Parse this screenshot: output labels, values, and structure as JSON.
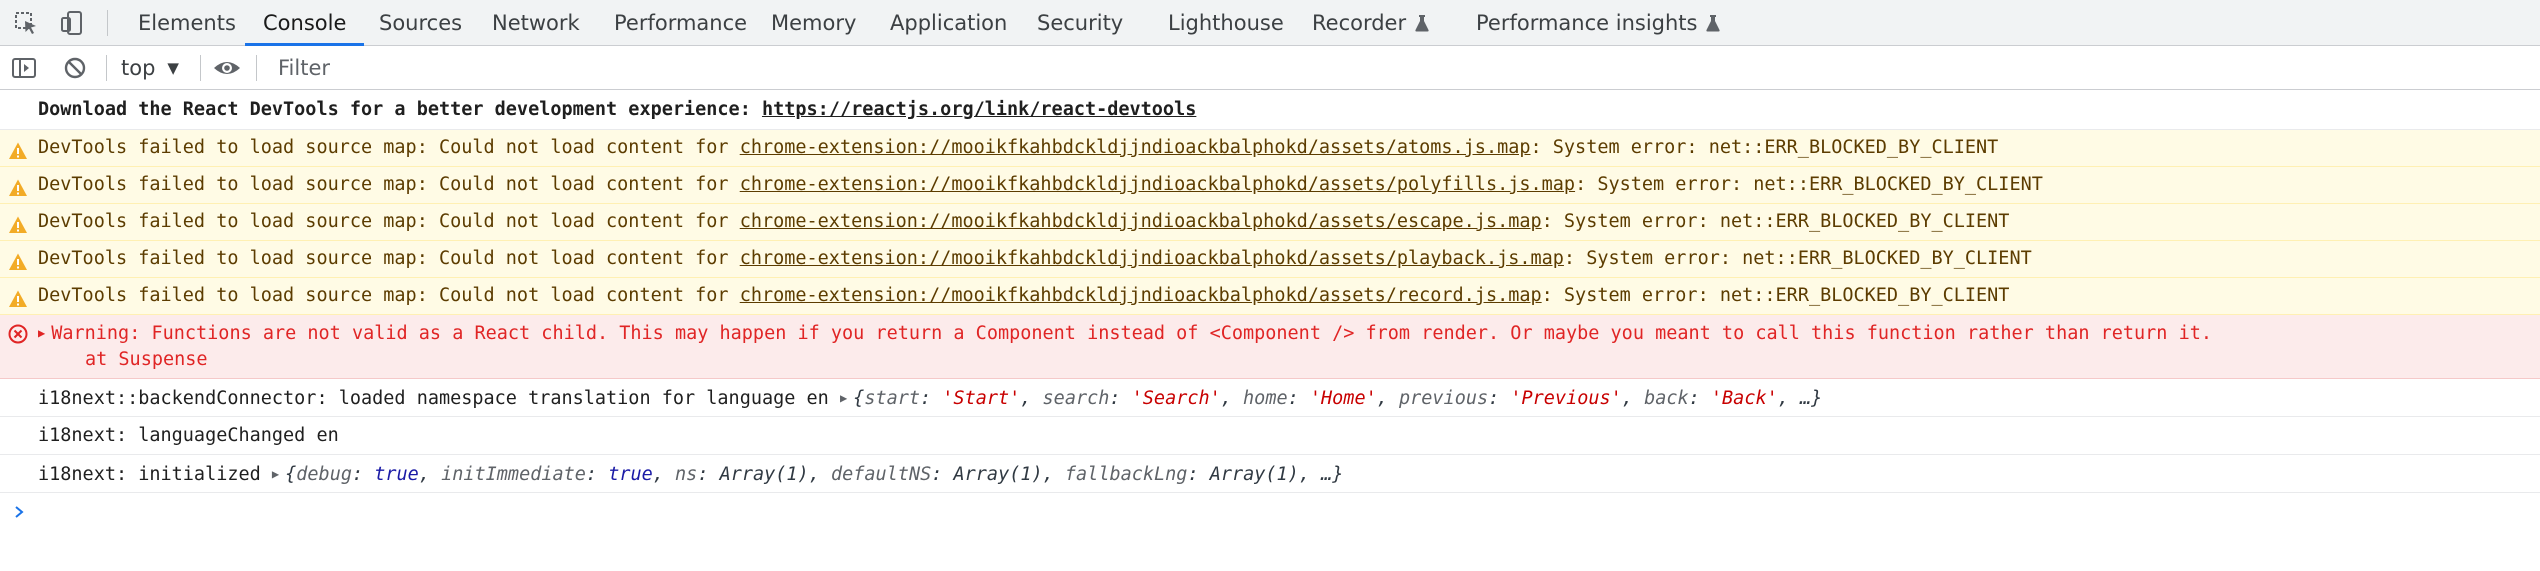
{
  "tabs": [
    {
      "label": "Elements",
      "active": false
    },
    {
      "label": "Console",
      "active": true
    },
    {
      "label": "Sources",
      "active": false
    },
    {
      "label": "Network",
      "active": false
    },
    {
      "label": "Performance",
      "active": false
    },
    {
      "label": "Memory",
      "active": false
    },
    {
      "label": "Application",
      "active": false
    },
    {
      "label": "Security",
      "active": false
    },
    {
      "label": "Lighthouse",
      "active": false
    },
    {
      "label": "Recorder",
      "active": false,
      "experimental_icon": "flask-icon"
    },
    {
      "label": "Performance insights",
      "active": false,
      "experimental_icon": "flask-icon"
    }
  ],
  "tabbar_icons": [
    "inspect-element-icon",
    "device-toolbar-icon"
  ],
  "toolbar": {
    "icons": [
      "sidebar-toggle-icon",
      "clear-console-icon",
      "live-expression-eye-icon"
    ],
    "context": "top",
    "filter_placeholder": "Filter",
    "filter_value": ""
  },
  "messages": {
    "react_devtools": {
      "text": "Download the React DevTools for a better development experience: ",
      "link": "https://reactjs.org/link/react-devtools"
    },
    "warnings": [
      {
        "prefix": "DevTools failed to load source map: Could not load content for ",
        "link": "chrome-extension://mooikfkahbdckldjjndioackbalphokd/assets/atoms.js.map",
        "suffix": ": System error: net::ERR_BLOCKED_BY_CLIENT"
      },
      {
        "prefix": "DevTools failed to load source map: Could not load content for ",
        "link": "chrome-extension://mooikfkahbdckldjjndioackbalphokd/assets/polyfills.js.map",
        "suffix": ": System error: net::ERR_BLOCKED_BY_CLIENT"
      },
      {
        "prefix": "DevTools failed to load source map: Could not load content for ",
        "link": "chrome-extension://mooikfkahbdckldjjndioackbalphokd/assets/escape.js.map",
        "suffix": ": System error: net::ERR_BLOCKED_BY_CLIENT"
      },
      {
        "prefix": "DevTools failed to load source map: Could not load content for ",
        "link": "chrome-extension://mooikfkahbdckldjjndioackbalphokd/assets/playback.js.map",
        "suffix": ": System error: net::ERR_BLOCKED_BY_CLIENT"
      },
      {
        "prefix": "DevTools failed to load source map: Could not load content for ",
        "link": "chrome-extension://mooikfkahbdckldjjndioackbalphokd/assets/record.js.map",
        "suffix": ": System error: net::ERR_BLOCKED_BY_CLIENT"
      }
    ],
    "error": {
      "line1": "Warning: Functions are not valid as a React child. This may happen if you return a Component instead of <Component /> from render. Or maybe you meant to call this function rather than return it.",
      "line2": "at Suspense"
    },
    "backend": {
      "text": "i18next::backendConnector: loaded namespace translation for language en ",
      "obj": {
        "open": "{",
        "k1": "start",
        "v1": "'Start'",
        "k2": "search",
        "v2": "'Search'",
        "k3": "home",
        "v3": "'Home'",
        "k4": "previous",
        "v4": "'Previous'",
        "k5": "back",
        "v5": "'Back'",
        "tail": ", …}"
      }
    },
    "language_changed": "i18next: languageChanged en",
    "initialized": {
      "text": "i18next: initialized ",
      "obj": {
        "open": "{",
        "k1": "debug",
        "v1": "true",
        "k2": "initImmediate",
        "v2": "true",
        "k3": "ns",
        "v3": "Array(1)",
        "k4": "defaultNS",
        "v4": "Array(1)",
        "k5": "fallbackLng",
        "v5": "Array(1)",
        "tail": ", …}"
      }
    }
  },
  "colors": {
    "accent": "#1a73e8",
    "warning_bg": "#fffbe5",
    "warning_icon": "#f2ab26",
    "error_bg": "#fcebeb",
    "error_text": "#e02525"
  }
}
